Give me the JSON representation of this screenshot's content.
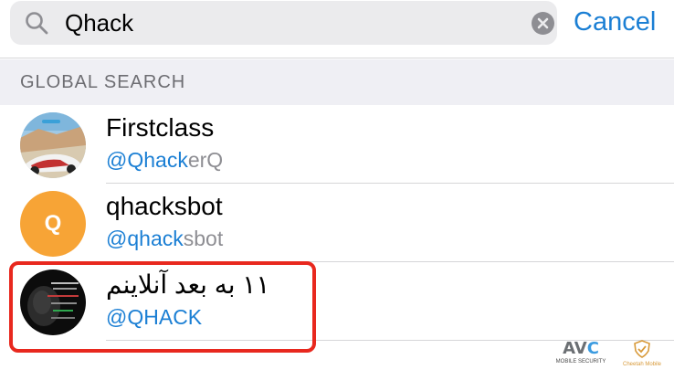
{
  "search": {
    "query": "Qhack",
    "cancel_label": "Cancel"
  },
  "section": {
    "title": "GLOBAL SEARCH"
  },
  "results": [
    {
      "name": "Firstclass",
      "handle_prefix": "@",
      "handle_match": "Qhack",
      "handle_rest": "erQ",
      "avatar": "racing-car-avatar"
    },
    {
      "name": "qhacksbot",
      "handle_prefix": "@",
      "handle_match": "qhack",
      "handle_rest": "sbot",
      "avatar_letter": "Q",
      "avatar_color": "#f7a436"
    },
    {
      "name": "۱۱ به بعد آنلاینم",
      "handle_prefix": "@",
      "handle_match": "QHACK",
      "handle_rest": "",
      "avatar": "dark-portrait-avatar"
    }
  ],
  "colors": {
    "accent": "#1b7fd4",
    "highlight_border": "#e8281e"
  },
  "watermarks": {
    "avc_logo_a": "AV",
    "avc_logo_b": "C",
    "avc_text": "MOBILE SECURITY",
    "cm_text": "Cheetah Mobile"
  }
}
